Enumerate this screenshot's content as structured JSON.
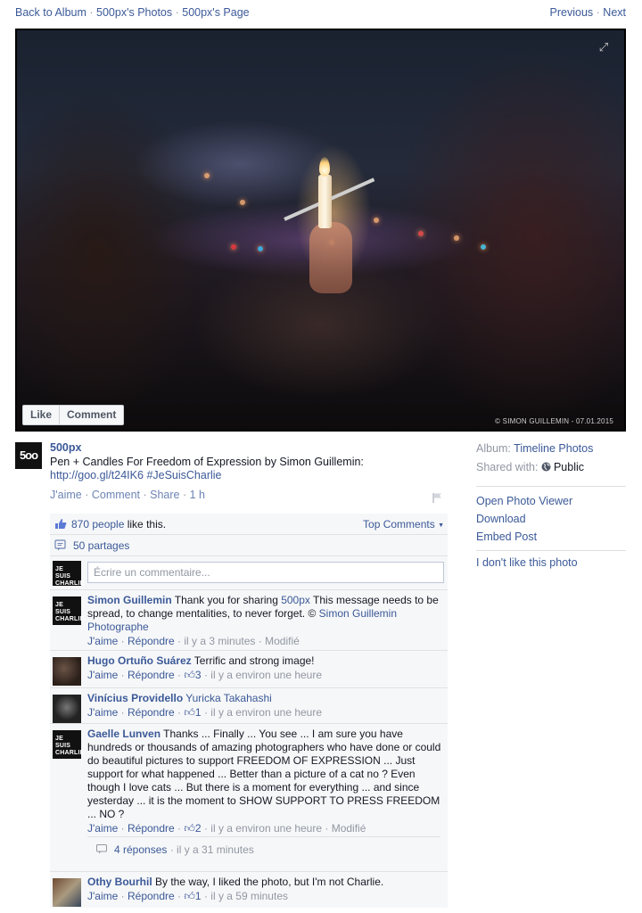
{
  "top_nav": {
    "back_to_album": "Back to Album",
    "photos_link": "500px's Photos",
    "page_link": "500px's Page",
    "separator": "·",
    "previous": "Previous",
    "next": "Next"
  },
  "photo": {
    "watermark": "© SIMON GUILLEMIN - 07.01.2015",
    "expand_icon": "expand-icon",
    "like_button": "Like",
    "comment_button": "Comment"
  },
  "post": {
    "avatar_text": "5oo",
    "author": "500px",
    "text": "Pen + Candles For Freedom of Expression by Simon Guillemin:",
    "link": "http://goo.gl/t24IK6",
    "hashtag": "#JeSuisCharlie",
    "action_like": "J'aime",
    "action_comment": "Comment",
    "action_share": "Share",
    "time": "1 h",
    "dot": " · "
  },
  "ufi": {
    "likes_count": "870 people",
    "likes_suffix": " like this.",
    "top_comments": "Top Comments",
    "shares": "50 partages",
    "compose_placeholder": "Écrire un commentaire...",
    "charlie_avatar": "JE SUIS CHARLIE"
  },
  "comments": [
    {
      "name": "Simon Guillemin",
      "text_1": " Thank you for sharing ",
      "mention_1": "500px",
      "text_2": " This message needs to be spread, to change mentalities, to never forget. © ",
      "mention_2": "Simon Guillemin Photographe",
      "like": "J'aime",
      "reply": "Répondre",
      "likes": "",
      "time": "il y a 3 minutes",
      "edited": "Modifié"
    },
    {
      "name": "Hugo Ortuño Suárez",
      "text_1": " Terrific and strong image!",
      "like": "J'aime",
      "reply": "Répondre",
      "likes": "3",
      "time": "il y a environ une heure"
    },
    {
      "name": "Vinícius Providello",
      "mention_1": "Yuricka Takahashi",
      "like": "J'aime",
      "reply": "Répondre",
      "likes": "1",
      "time": "il y a environ une heure"
    },
    {
      "name": "Gaelle Lunven",
      "text_1": " Thanks ... Finally ... You see ... I am sure you have hundreds or thousands of amazing photographers who have done or could do beautiful pictures to support FREEDOM OF EXPRESSION ... Just support for what happened ... Better than a picture of a cat no ? Even though I love cats ... But there is a moment for everything ... and since yesterday ... it is the moment to SHOW SUPPORT TO PRESS FREEDOM ... NO ?",
      "like": "J'aime",
      "reply": "Répondre",
      "likes": "2",
      "time": "il y a environ une heure",
      "edited": "Modifié",
      "replies": "4 réponses",
      "replies_time": "il y a 31 minutes"
    },
    {
      "name": "Othy Bourhil",
      "text_1": " By the way, I liked the photo, but I'm not Charlie.",
      "like": "J'aime",
      "reply": "Répondre",
      "likes": "1",
      "time": "il y a 59 minutes"
    }
  ],
  "sidebar": {
    "album_label": "Album: ",
    "album_value": "Timeline Photos",
    "shared_label": "Shared with: ",
    "shared_value": "Public",
    "open_viewer": "Open Photo Viewer",
    "download": "Download",
    "embed": "Embed Post",
    "dislike": "I don't like this photo"
  },
  "colors": {
    "link": "#3b5998",
    "muted": "#9197a3",
    "ufi_bg": "#f6f7f8"
  }
}
